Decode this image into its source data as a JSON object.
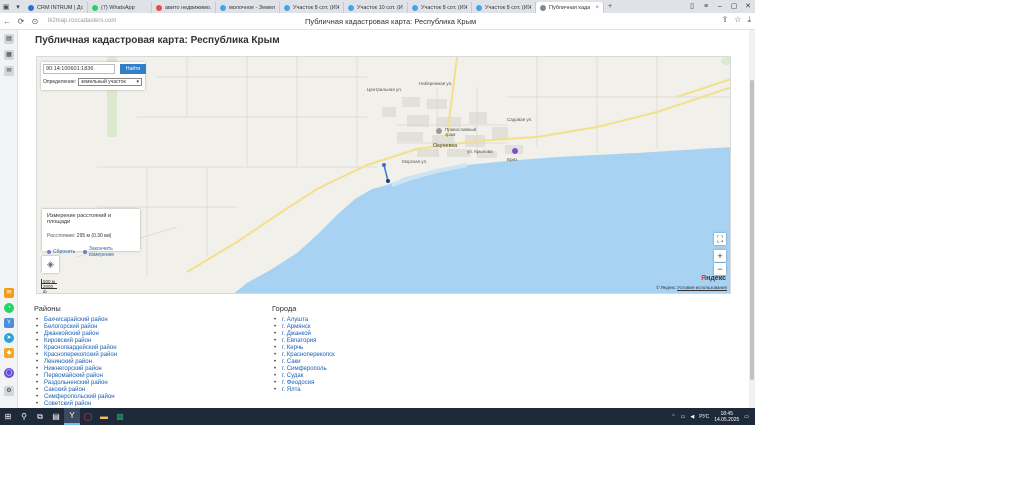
{
  "browser": {
    "tabs": [
      {
        "label": "CRM INTRUM | Дом",
        "color": "#2b6fd6",
        "active": false
      },
      {
        "label": "(7) WhatsApp",
        "color": "#25d366",
        "active": false
      },
      {
        "label": "авито недвижимо...",
        "color": "#e84a4a",
        "active": false
      },
      {
        "label": "молочное - Земель...",
        "color": "#4aa3e8",
        "active": false
      },
      {
        "label": "Участок 8 сот. (ИЖС",
        "color": "#4aa3e8",
        "active": false
      },
      {
        "label": "Участок 10 сот. (ИЖ",
        "color": "#4aa3e8",
        "active": false
      },
      {
        "label": "Участок 8 сот. (ИЖ",
        "color": "#4aa3e8",
        "active": false
      },
      {
        "label": "Участок 8 сот. (ИЖС",
        "color": "#4aa3e8",
        "active": false
      },
      {
        "label": "Публичная кадастр...",
        "color": "#888888",
        "active": true
      }
    ],
    "url": "lk2map.roscadasters.com",
    "page_title": "Публичная кадастровая карта: Республика Крым"
  },
  "page": {
    "heading": "Публичная кадастровая карта: Республика Крым"
  },
  "map": {
    "search_value": "90:14:100601:1836",
    "find_label": "Найти",
    "definition_label": "Определение:",
    "definition_value": "земельный участок",
    "measure_title": "Измерение расстояний и площади",
    "measure_distance_label": "Расстояние:",
    "measure_distance_value": "295 м (0.30 км)",
    "measure_reset": "Сбросить",
    "measure_finish": "Закончить измерение",
    "scale_top": "500 м",
    "scale_bottom": "2000 ф",
    "town_label": "Окуневка",
    "church_label": "Православный храм",
    "street_labels": [
      "Набережная ул.",
      "Центральная ул.",
      "ул. Крылова",
      "Садовая ул.",
      "Морская ул."
    ],
    "poi_label": "Бриз",
    "yandex_logo_prefix": "Я",
    "yandex_logo_rest": "ндекс",
    "copyright": "© Яндекс",
    "terms": "Условия использования",
    "sea_color": "#a7d2f2",
    "land_color": "#f1f0ea"
  },
  "districts": {
    "title": "Районы",
    "items": [
      "Бахчисарайский район",
      "Белогорский район",
      "Джанкойский район",
      "Кировский район",
      "Красногвардейский район",
      "Красноперекопский район",
      "Ленинский район",
      "Нижнегорский район",
      "Первомайский район",
      "Раздольненский район",
      "Сакский район",
      "Симферопольский район",
      "Советский район"
    ]
  },
  "cities": {
    "title": "Города",
    "items": [
      "г. Алушта",
      "г. Армянск",
      "г. Джанкой",
      "г. Евпатория",
      "г. Керчь",
      "г. Красноперекопск",
      "г. Саки",
      "г. Симферополь",
      "г. Судак",
      "г. Феодосия",
      "г. Ялта"
    ]
  },
  "taskbar": {
    "lang": "РУС",
    "time": "18:45",
    "date": "14.05.2025"
  }
}
